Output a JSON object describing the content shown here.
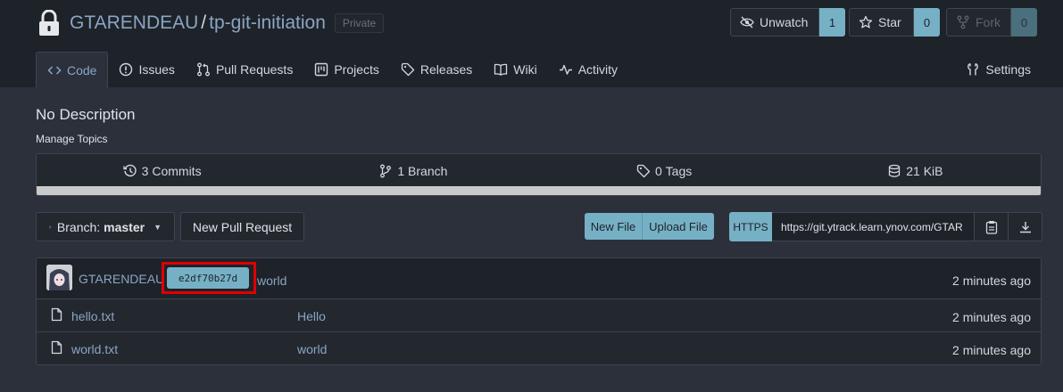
{
  "repo": {
    "owner": "GTARENDEAU",
    "separator": "/",
    "name": "tp-git-initiation",
    "visibility": "Private"
  },
  "header_buttons": {
    "unwatch": {
      "label": "Unwatch",
      "count": "1"
    },
    "star": {
      "label": "Star",
      "count": "0"
    },
    "fork": {
      "label": "Fork",
      "count": "0"
    }
  },
  "tabs": [
    {
      "label": "Code",
      "icon": "code-icon"
    },
    {
      "label": "Issues",
      "icon": "issue-icon"
    },
    {
      "label": "Pull Requests",
      "icon": "pull-request-icon"
    },
    {
      "label": "Projects",
      "icon": "project-icon"
    },
    {
      "label": "Releases",
      "icon": "tag-icon"
    },
    {
      "label": "Wiki",
      "icon": "book-icon"
    },
    {
      "label": "Activity",
      "icon": "pulse-icon"
    }
  ],
  "settings_label": "Settings",
  "description": "No Description",
  "manage_topics": "Manage Topics",
  "stats": {
    "commits_count": "3",
    "commits_label": "Commits",
    "branches_count": "1",
    "branches_label": "Branch",
    "tags_count": "0",
    "tags_label": "Tags",
    "size": "21 KiB"
  },
  "toolbar": {
    "branch_prefix": "Branch:",
    "branch_name": "master",
    "new_pull_request": "New Pull Request",
    "new_file": "New File",
    "upload_file": "Upload File",
    "clone_protocol": "HTTPS",
    "clone_url": "https://git.ytrack.learn.ynov.com/GTAR"
  },
  "latest_commit": {
    "author": "GTARENDEAU",
    "sha": "e2df70b27d",
    "message": "world",
    "time": "2 minutes ago"
  },
  "files": [
    {
      "name": "hello.txt",
      "message": "Hello",
      "time": "2 minutes ago"
    },
    {
      "name": "world.txt",
      "message": "world",
      "time": "2 minutes ago"
    }
  ],
  "colors": {
    "accent": "#76b0c5",
    "link": "#8aa5c4",
    "highlight": "#e00000",
    "background": "#2b303b",
    "header": "#1e2229"
  }
}
